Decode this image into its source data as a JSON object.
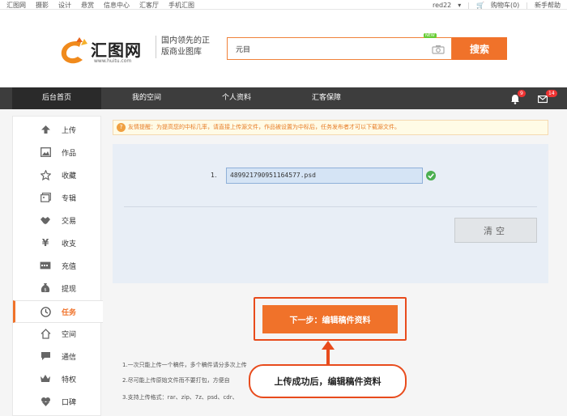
{
  "topbar": {
    "links": [
      "汇图网",
      "摄影",
      "设计",
      "悬赏",
      "信息中心",
      "汇客厅",
      "手机汇图"
    ],
    "user": "red22",
    "cart": "购物车(0)",
    "help": "新手帮助"
  },
  "header": {
    "logo_text": "汇图网",
    "logo_url": "www.huitu.com",
    "slogan_line1": "国内领先的正",
    "slogan_line2": "版商业图库",
    "search_value": "元目",
    "new_badge": "NEW",
    "search_button": "搜索"
  },
  "nav": {
    "items": [
      "后台首页",
      "我的空间",
      "个人资料",
      "汇客保障"
    ],
    "bell_count": "9",
    "mail_count": "14"
  },
  "sidebar": {
    "items": [
      {
        "label": "上传",
        "icon": "upload-icon"
      },
      {
        "label": "作品",
        "icon": "image-icon"
      },
      {
        "label": "收藏",
        "icon": "star-icon"
      },
      {
        "label": "专辑",
        "icon": "album-icon"
      },
      {
        "label": "交易",
        "icon": "handshake-icon"
      },
      {
        "label": "收支",
        "icon": "yuan-icon"
      },
      {
        "label": "充值",
        "icon": "card-icon"
      },
      {
        "label": "提现",
        "icon": "moneybag-icon"
      },
      {
        "label": "任务",
        "icon": "clock-icon"
      },
      {
        "label": "空间",
        "icon": "home-icon"
      },
      {
        "label": "通信",
        "icon": "chat-icon"
      },
      {
        "label": "特权",
        "icon": "crown-icon"
      },
      {
        "label": "口碑",
        "icon": "reputation-icon"
      }
    ],
    "active_index": 8
  },
  "notice": {
    "text": "友情提醒：为提高您的中标几率，请直接上传源文件，作品被设置为中标后，任务发布者才可以下载源文件。"
  },
  "upload": {
    "file_number": "1.",
    "file_name": "489921790951164577.psd",
    "clear_button": "清空"
  },
  "next_button": "下一步：编辑稿件资料",
  "tips": [
    "1.一次只能上传一个稿件，多个稿件请分多次上传",
    "2.尽可能上传原始文件而不要打包，方便自",
    "3.支持上传格式：rar、zip、7z、psd、cdr、"
  ],
  "callout": "上传成功后，编辑稿件资料",
  "colors": {
    "accent": "#f0722a",
    "callout_border": "#e84b1c",
    "nav_bg": "#3d3d3d"
  }
}
